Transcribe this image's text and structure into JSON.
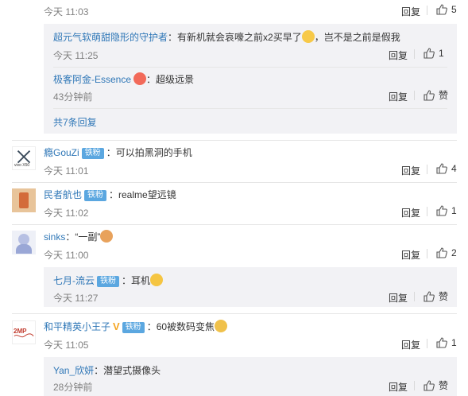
{
  "c1": {
    "time": "今天 11:03",
    "reply": "回复",
    "likes": "5"
  },
  "s1a": {
    "user": "超元气软萌甜隐形的守护者",
    "text": "：有新机就会哀嚎之前x2买早了",
    "text2": "，岂不是之前是假我",
    "time": "今天 11:25",
    "reply": "回复",
    "likes": "1"
  },
  "s1b": {
    "user": "极客阿金-Essence",
    "text": "：超级远景",
    "time": "43分钟前",
    "reply": "回复",
    "likes": "赞"
  },
  "s1more": {
    "label": "共7条回复"
  },
  "c2": {
    "user": "瘾GouZi",
    "badge": "铁粉",
    "text": "：可以拍黑洞的手机",
    "avatar_text": "vivo X50",
    "time": "今天 11:01",
    "reply": "回复",
    "likes": "4"
  },
  "c3": {
    "user": "民者航也",
    "badge": "铁粉",
    "text": "：realme望远镜",
    "time": "今天 11:02",
    "reply": "回复",
    "likes": "1"
  },
  "c4": {
    "user": "sinks",
    "text": "：“一副”",
    "time": "今天 11:00",
    "reply": "回复",
    "likes": "2"
  },
  "s4a": {
    "user": "七月-流云",
    "badge": "铁粉",
    "text": "：耳机",
    "time": "今天 11:27",
    "reply": "回复",
    "likes": "赞"
  },
  "c5": {
    "user": "和平精英小王子",
    "badge": "铁粉",
    "vip": "V",
    "text": "：60被数码变焦",
    "avatar_text": "2MP",
    "time": "今天 11:05",
    "reply": "回复",
    "likes": "1"
  },
  "s5a": {
    "user": "Yan_欣妍",
    "text": "：潜望式摄像头",
    "time": "28分钟前",
    "reply": "回复",
    "likes": "赞"
  },
  "colors": {
    "name": "#eb7350",
    "blue": "#2f77b7",
    "subbox": "#f2f2f5",
    "badge": "#5ba7e0"
  }
}
